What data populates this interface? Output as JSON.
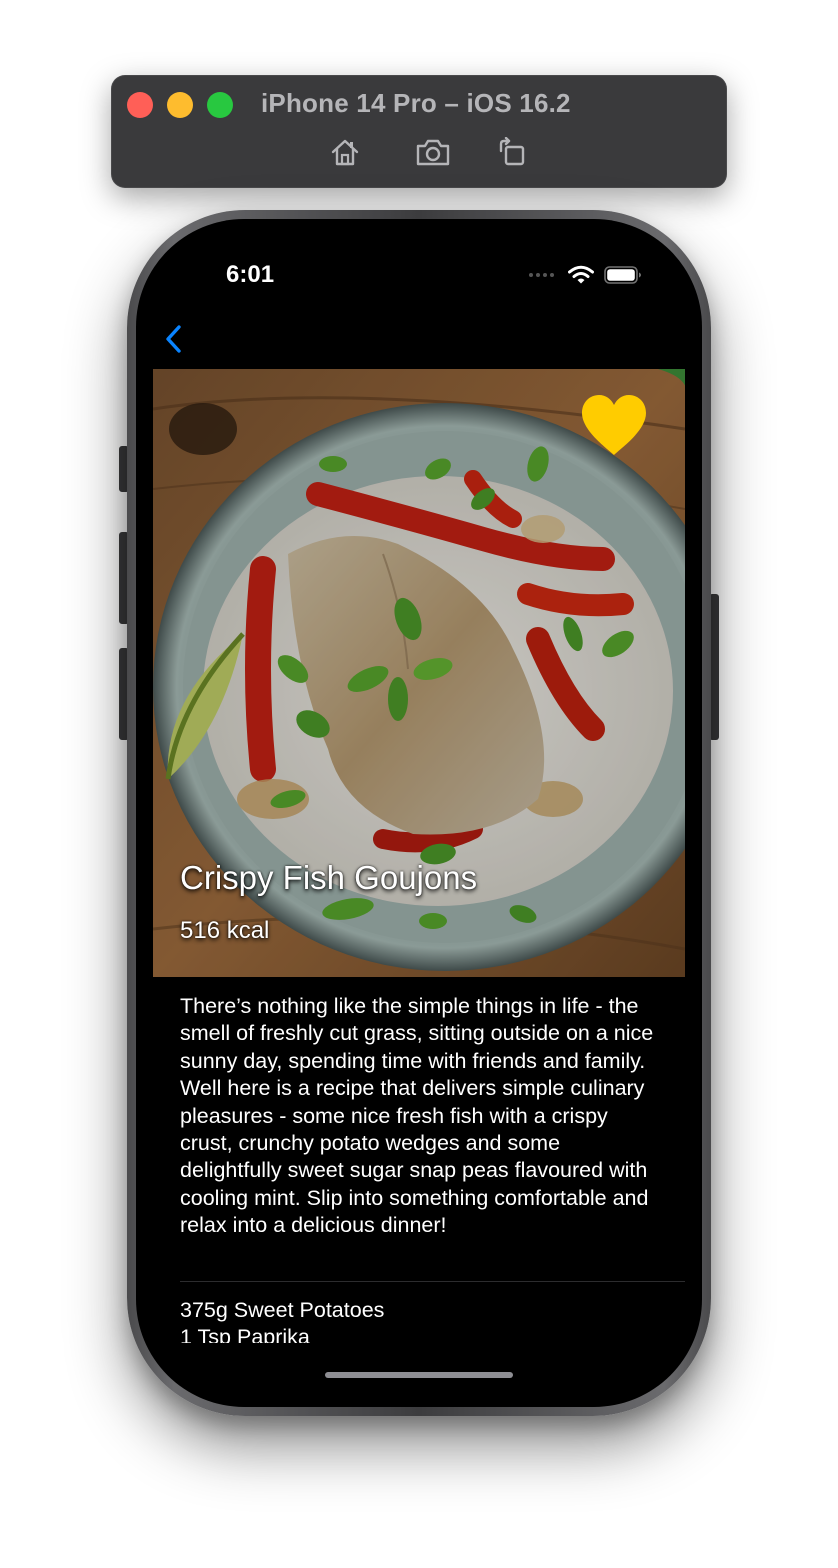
{
  "simulator": {
    "title": "iPhone 14 Pro – iOS 16.2",
    "buttons": [
      "home-icon",
      "screenshot-icon",
      "rotate-icon"
    ]
  },
  "status_bar": {
    "time": "6:01",
    "icons": [
      "signal-icon",
      "wifi-icon",
      "battery-icon"
    ]
  },
  "nav": {
    "back_icon": "chevron-left-icon",
    "accent_color": "#0a84ff"
  },
  "recipe": {
    "title": "Crispy Fish Goujons",
    "calories": "516 kcal",
    "favorite_icon": "heart-icon",
    "favorite_color": "#ffcc00",
    "description": "There’s nothing like the simple things in life - the smell of freshly cut grass, sitting outside on a nice sunny day, spending time with friends and family. Well here is a recipe that delivers simple culinary pleasures - some nice fresh fish with a crispy crust, crunchy potato wedges and some delightfully sweet sugar snap peas flavoured with cooling mint. Slip into something comfortable and relax into a delicious dinner!",
    "ingredients": [
      "375g Sweet Potatoes",
      "1 Tsp Paprika"
    ]
  }
}
